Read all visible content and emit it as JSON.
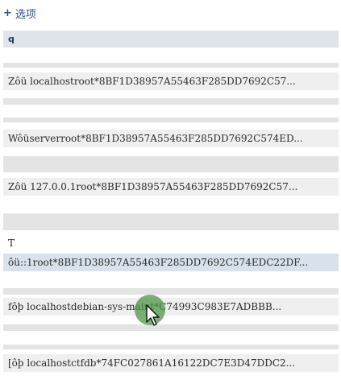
{
  "options": {
    "plus": "+",
    "label": "选项"
  },
  "header": {
    "label": "q"
  },
  "rows": [
    {
      "text": "Zôü localhostroot*8BF1D38957A55463F285DD7692C57..."
    },
    {
      "text": "Wôüserverroot*8BF1D38957A55463F285DD7692C574ED..."
    },
    {
      "text": "Zôü 127.0.0.1root*8BF1D38957A55463F285DD7692C57..."
    },
    {
      "text": "ôü::1root*8BF1D38957A55463F285DD7692C574EDC22DF..."
    },
    {
      "text": "fôþ localhostdebian-sys-maint*C74993C983E7ADBBB..."
    },
    {
      "text": "[ôþ localhostctfdb*74FC027861A16122DC7E3D47DDC2..."
    }
  ],
  "label_t": "T",
  "colors": {
    "link": "#2a4f8a",
    "highlight": "#d8e1ec",
    "cursor_halo": "#4c9646"
  }
}
